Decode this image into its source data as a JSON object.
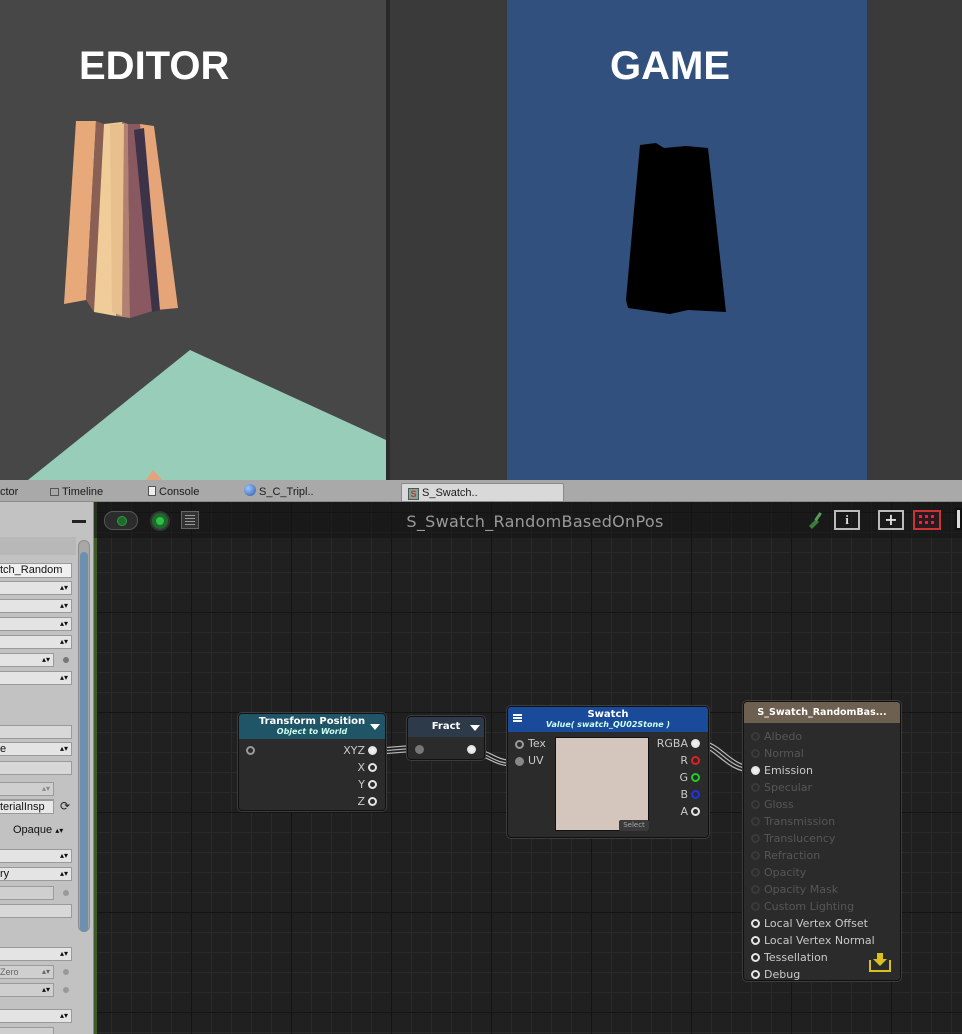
{
  "editor_view": {
    "title": "EDITOR"
  },
  "game_view": {
    "title": "GAME"
  },
  "tabs": [
    {
      "label": "ctor"
    },
    {
      "label": "Timeline"
    },
    {
      "label": "Console"
    },
    {
      "label": "S_C_Tripl.."
    },
    {
      "label": "S_Swatch.."
    }
  ],
  "inspector": {
    "shader_name": "tch_Random",
    "material_inspector": "terialInsp",
    "render_type": "Opaque",
    "field_e": "e",
    "field_ry": "ry",
    "field_zero": "Zero"
  },
  "graph": {
    "title": "S_Swatch_RandomBasedOnPos"
  },
  "nodes": {
    "transform_position": {
      "title": "Transform Position",
      "subtitle": "Object to World",
      "outputs": [
        "XYZ",
        "X",
        "Y",
        "Z"
      ]
    },
    "fract": {
      "title": "Fract"
    },
    "swatch": {
      "title": "Swatch",
      "subtitle": "Value( swatch_QU02Stone )",
      "inputs": [
        "Tex",
        "UV"
      ],
      "outputs": [
        "RGBA",
        "R",
        "G",
        "B",
        "A"
      ],
      "select_label": "Select",
      "preview_color": "#d4c6bc"
    },
    "output": {
      "title": "S_Swatch_RandomBas...",
      "inputs": [
        {
          "label": "Albedo",
          "active": false
        },
        {
          "label": "Normal",
          "active": false
        },
        {
          "label": "Emission",
          "active": true
        },
        {
          "label": "Specular",
          "active": false
        },
        {
          "label": "Gloss",
          "active": false
        },
        {
          "label": "Transmission",
          "active": false
        },
        {
          "label": "Translucency",
          "active": false
        },
        {
          "label": "Refraction",
          "active": false
        },
        {
          "label": "Opacity",
          "active": false
        },
        {
          "label": "Opacity Mask",
          "active": false
        },
        {
          "label": "Custom Lighting",
          "active": false
        },
        {
          "label": "Local Vertex Offset",
          "active": true
        },
        {
          "label": "Local Vertex Normal",
          "active": true
        },
        {
          "label": "Tessellation",
          "active": true
        },
        {
          "label": "Debug",
          "active": true
        }
      ]
    }
  },
  "colors": {
    "game_bg": "#32507d",
    "editor_bg": "#474747",
    "ground": "#98cdb9",
    "transform_header": "#1f5566",
    "fract_header": "#2d3a4a",
    "swatch_header": "#1a4a9a",
    "output_header": "#6e6050"
  }
}
